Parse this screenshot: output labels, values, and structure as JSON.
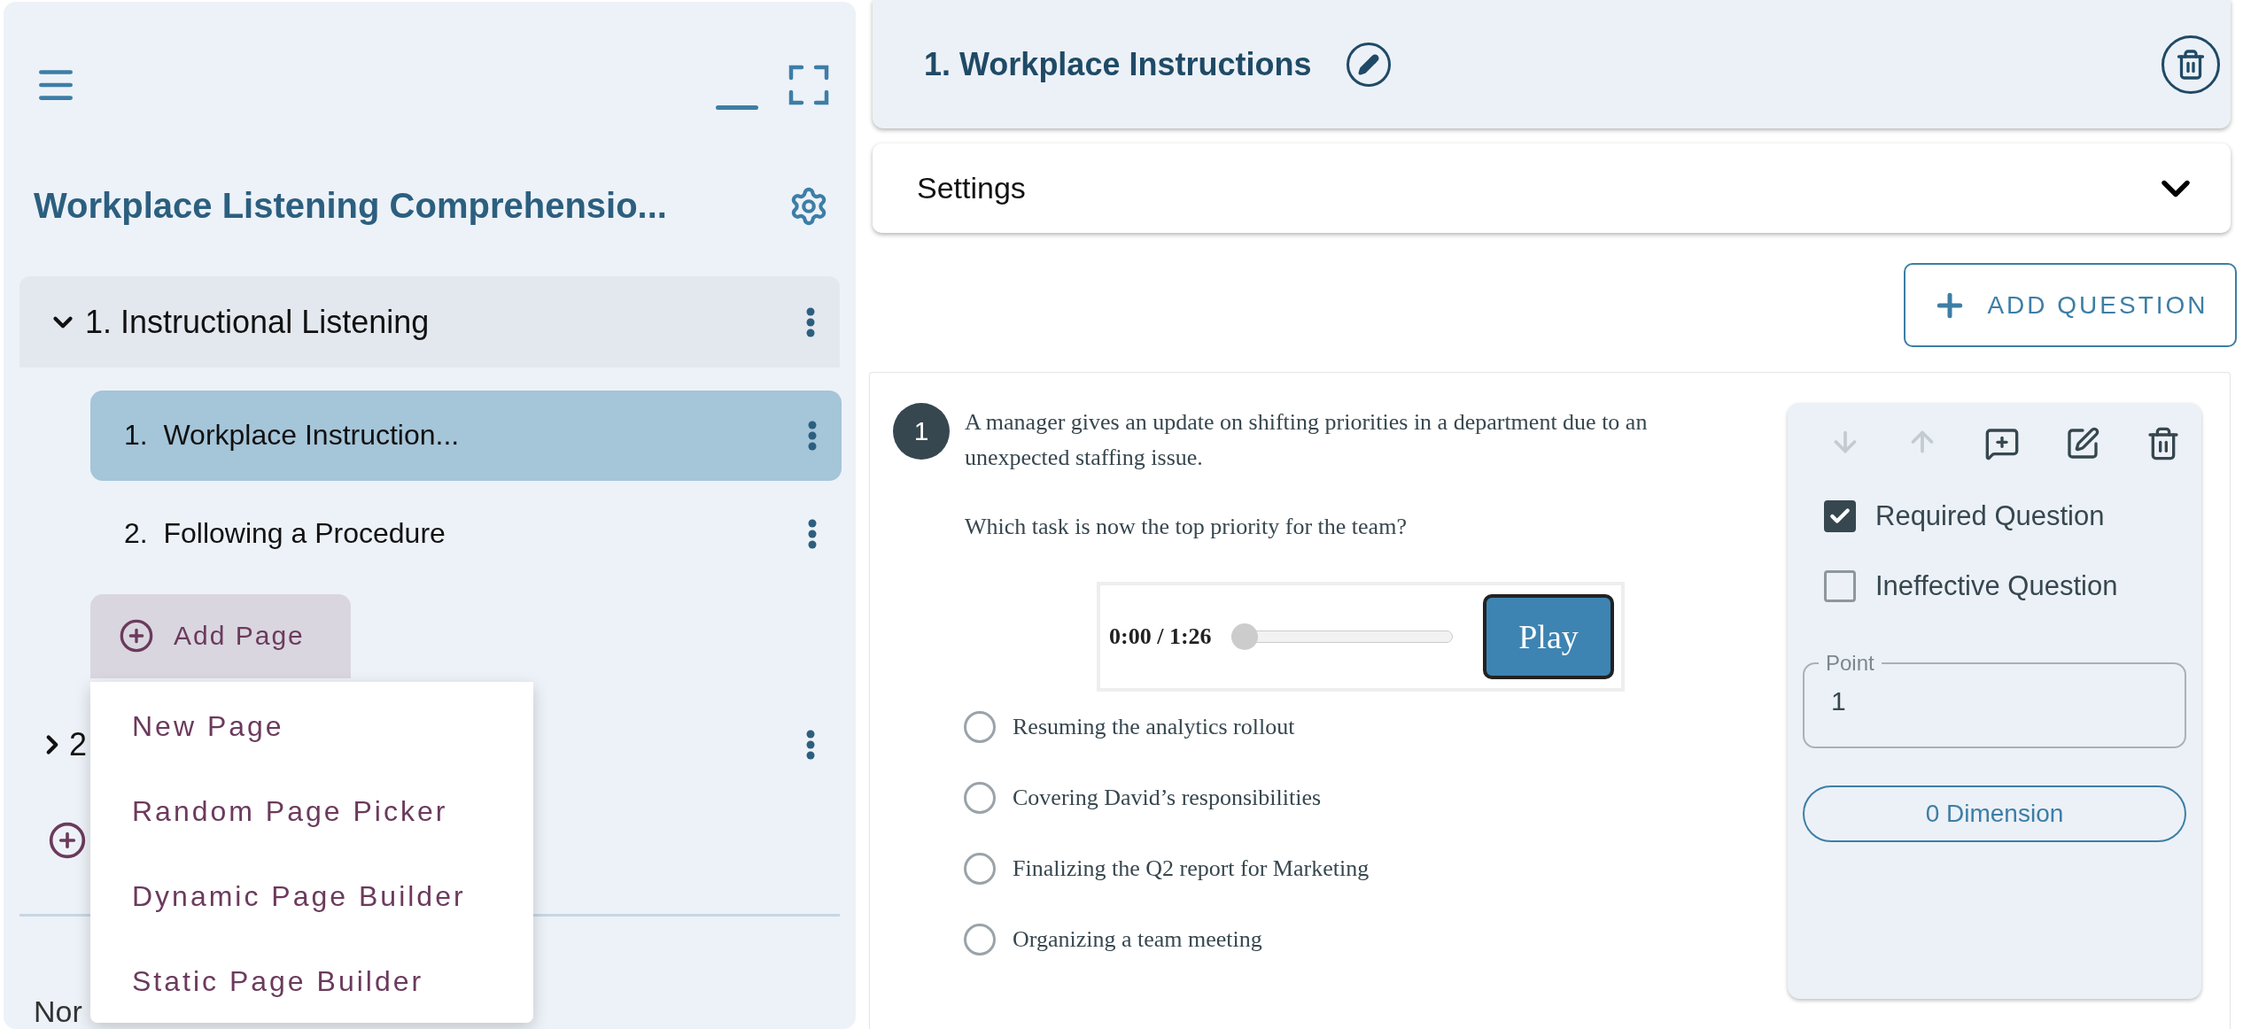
{
  "sidebar": {
    "title": "Workplace Listening Comprehensio...",
    "sections": [
      {
        "label": "1. Instructional Listening",
        "expanded": true,
        "pages": [
          {
            "number": "1.",
            "label": "Workplace Instruction...",
            "selected": true
          },
          {
            "number": "2.",
            "label": "Following a Procedure",
            "selected": false
          }
        ]
      },
      {
        "label": "2",
        "expanded": false
      }
    ],
    "add_page_button": "Add Page",
    "add_page_menu": [
      "New Page",
      "Random Page Picker",
      "Dynamic Page Builder",
      "Static Page Builder"
    ],
    "footer_text": "Nor"
  },
  "page_header": {
    "title": "1. Workplace Instructions"
  },
  "settings": {
    "label": "Settings",
    "expanded": false
  },
  "add_question_button": "ADD QUESTION",
  "question": {
    "number": "1",
    "prompt": [
      "A manager gives an update on shifting priorities in a department due to an unexpected staffing issue.",
      "Which task is now the top priority for the team?"
    ],
    "audio": {
      "time": "0:00 / 1:26",
      "level": 0,
      "button": "Play"
    },
    "options": [
      {
        "label": "Resuming the analytics rollout",
        "selected": false
      },
      {
        "label": "Covering David’s responsibilities",
        "selected": false
      },
      {
        "label": "Finalizing the Q2 report for Marketing",
        "selected": false
      },
      {
        "label": "Organizing a team meeting",
        "selected": false
      }
    ],
    "tools": [
      {
        "kind": "move-down",
        "disabled": true
      },
      {
        "kind": "move-up",
        "disabled": true
      },
      {
        "kind": "comment",
        "disabled": false
      },
      {
        "kind": "edit",
        "disabled": false
      },
      {
        "kind": "delete",
        "disabled": false
      }
    ],
    "checks": [
      {
        "label": "Required Question",
        "checked": true
      },
      {
        "label": "Ineffective Question",
        "checked": false
      }
    ],
    "point_field": {
      "label": "Point",
      "value": "1"
    },
    "dimension_button": "0 Dimension"
  }
}
